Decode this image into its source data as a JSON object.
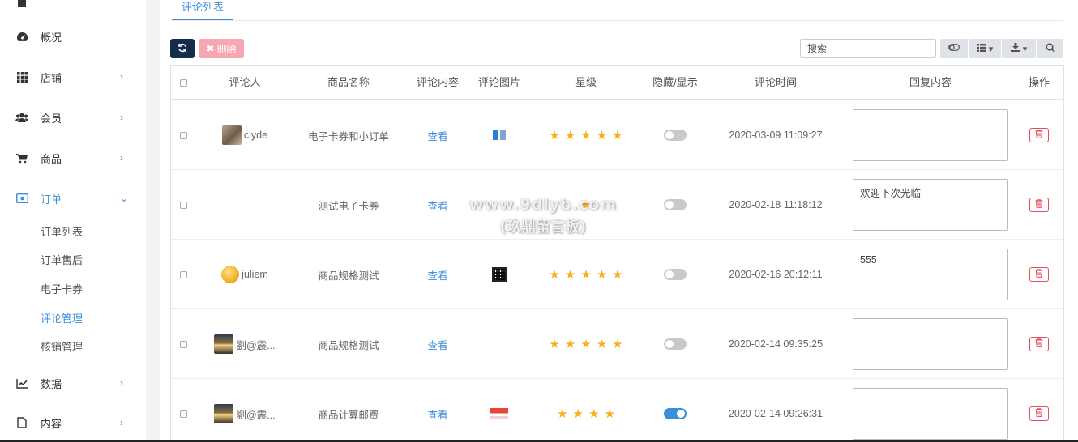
{
  "sidebar": {
    "items": [
      {
        "label": "概况",
        "icon": "dashboard-icon"
      },
      {
        "label": "店铺",
        "icon": "grid-icon"
      },
      {
        "label": "会员",
        "icon": "users-icon"
      },
      {
        "label": "商品",
        "icon": "cart-icon"
      },
      {
        "label": "订单",
        "icon": "order-icon"
      },
      {
        "label": "数据",
        "icon": "chart-line-icon"
      },
      {
        "label": "内容",
        "icon": "file-icon"
      }
    ],
    "order_sub": [
      "订单列表",
      "订单售后",
      "电子卡券",
      "评论管理",
      "核销管理"
    ]
  },
  "tabs": {
    "comments": "评论列表"
  },
  "toolbar": {
    "delete_label": "删除",
    "search_placeholder": "搜索"
  },
  "table": {
    "headers": [
      "评论人",
      "商品名称",
      "评论内容",
      "评论图片",
      "星级",
      "隐藏/显示",
      "评论时间",
      "回复内容",
      "操作"
    ],
    "rows": [
      {
        "user": "clyde",
        "product": "电子卡券和小订单",
        "content": "查看",
        "stars": 5,
        "visible": false,
        "time": "2020-03-09 11:09:27",
        "reply": ""
      },
      {
        "user": "",
        "product": "测试电子卡券",
        "content": "查看",
        "stars": 1,
        "visible": false,
        "time": "2020-02-18 11:18:12",
        "reply": "欢迎下次光临"
      },
      {
        "user": "juliem",
        "product": "商品规格测试",
        "content": "查看",
        "stars": 5,
        "visible": false,
        "time": "2020-02-16 20:12:11",
        "reply": "555"
      },
      {
        "user": "劉@震...",
        "product": "商品规格测试",
        "content": "查看",
        "stars": 5,
        "visible": false,
        "time": "2020-02-14 09:35:25",
        "reply": ""
      },
      {
        "user": "劉@震...",
        "product": "商品计算邮费",
        "content": "查看",
        "stars": 4,
        "visible": true,
        "time": "2020-02-14 09:26:31",
        "reply": ""
      }
    ]
  },
  "watermark": {
    "line1": "www.9dlyb.com",
    "line2": "(玖鼎留言板)"
  },
  "colors": {
    "accent": "#3b8ed8",
    "refresh_btn": "#142d4c",
    "delete_btn": "#f5a8b3",
    "star": "#f6b01e",
    "danger": "#e04f5f"
  }
}
